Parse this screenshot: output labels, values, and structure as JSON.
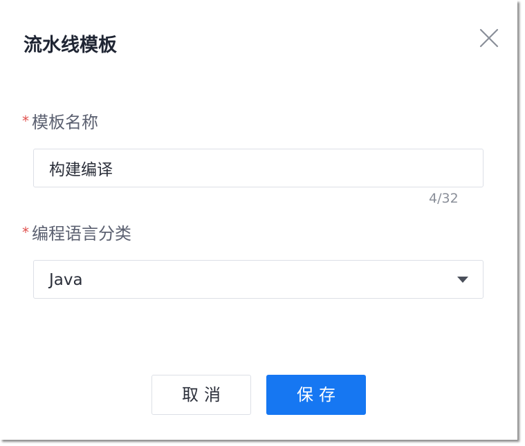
{
  "dialog": {
    "title": "流水线模板",
    "close_icon": "close-icon"
  },
  "form": {
    "required_mark": "*",
    "template_name": {
      "label": "模板名称",
      "value": "构建编译",
      "counter": "4/32"
    },
    "language": {
      "label": "编程语言分类",
      "selected": "Java",
      "arrow_icon": "caret-down-icon"
    }
  },
  "actions": {
    "cancel_label": "取消",
    "save_label": "保存"
  },
  "colors": {
    "primary": "#1677f2",
    "required": "#e0504d",
    "border": "#dcdfe6",
    "title": "#1f2533"
  }
}
